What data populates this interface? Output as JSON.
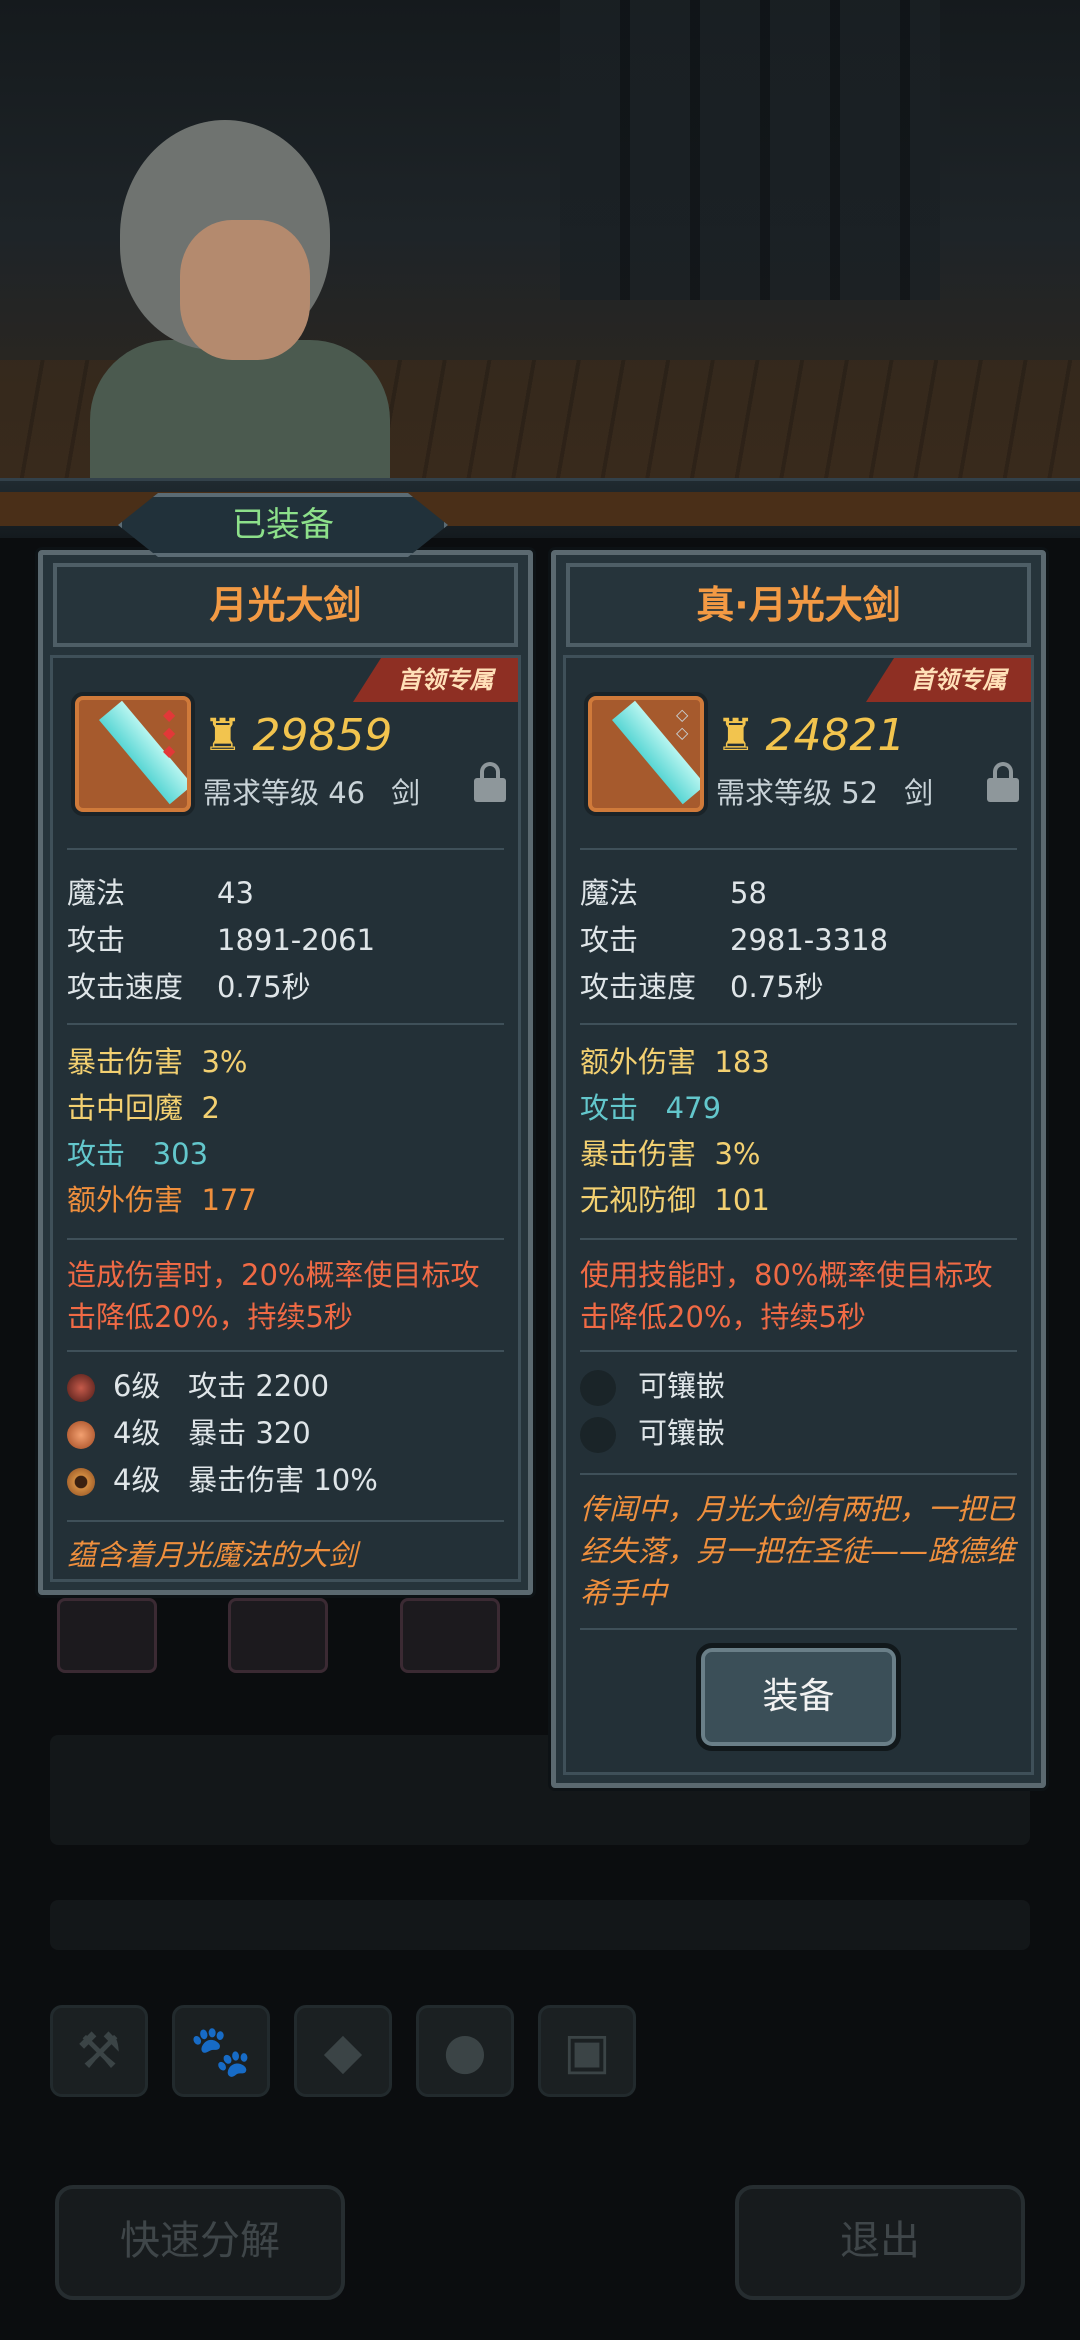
{
  "tab": {
    "label": "已装备"
  },
  "left": {
    "title": "月光大剑",
    "badge": "首领专属",
    "power": "29859",
    "req_label": "需求等级",
    "req_level": "46",
    "type": "剑",
    "stats": [
      {
        "k": "魔法",
        "v": "43"
      },
      {
        "k": "攻击",
        "v": "1891-2061"
      },
      {
        "k": "攻击速度",
        "v": "0.75秒"
      }
    ],
    "extra": [
      {
        "k": "暴击伤害",
        "v": "3%",
        "color": "#f3d071"
      },
      {
        "k": "击中回魔",
        "v": "2",
        "color": "#f3d071"
      },
      {
        "k": "攻击",
        "v": "303",
        "color": "#63c7cc"
      },
      {
        "k": "额外伤害",
        "v": "177",
        "color": "#ef8f3d"
      }
    ],
    "effect": "造成伤害时，20%概率使目标攻击降低20%，持续5秒",
    "gems": [
      {
        "level": "6级",
        "stat": "攻击 2200",
        "icon": "red-gem-icon"
      },
      {
        "level": "4级",
        "stat": "暴击 320",
        "icon": "orange-gem-icon"
      },
      {
        "level": "4级",
        "stat": "暴击伤害 10%",
        "icon": "amber-gem-icon"
      }
    ],
    "flavor": "蕴含着月光魔法的大剑"
  },
  "right": {
    "title": "真·月光大剑",
    "badge": "首领专属",
    "power": "24821",
    "req_label": "需求等级",
    "req_level": "52",
    "type": "剑",
    "stats": [
      {
        "k": "魔法",
        "v": "58"
      },
      {
        "k": "攻击",
        "v": "2981-3318"
      },
      {
        "k": "攻击速度",
        "v": "0.75秒"
      }
    ],
    "extra": [
      {
        "k": "额外伤害",
        "v": "183",
        "color": "#f3d071"
      },
      {
        "k": "攻击",
        "v": "479",
        "color": "#63c7cc"
      },
      {
        "k": "暴击伤害",
        "v": "3%",
        "color": "#f3d071"
      },
      {
        "k": "无视防御",
        "v": "101",
        "color": "#f3d071"
      }
    ],
    "effect": "使用技能时，80%概率使目标攻击降低20%，持续5秒",
    "sockets": [
      "可镶嵌",
      "可镶嵌"
    ],
    "flavor": "传闻中，月光大剑有两把，一把已经失落，另一把在圣徒——路德维希手中",
    "equip_label": "装备"
  },
  "bottom": {
    "quick_decompose": "快速分解",
    "exit": "退出"
  },
  "icons": [
    "hammer-icon",
    "paw-icon",
    "diamond-icon",
    "egg-icon",
    "chest-icon"
  ],
  "colors": {
    "title": "#f39a44",
    "power": "#f2c44e",
    "effect": "#f06a45",
    "badge": "#8e2f23"
  }
}
